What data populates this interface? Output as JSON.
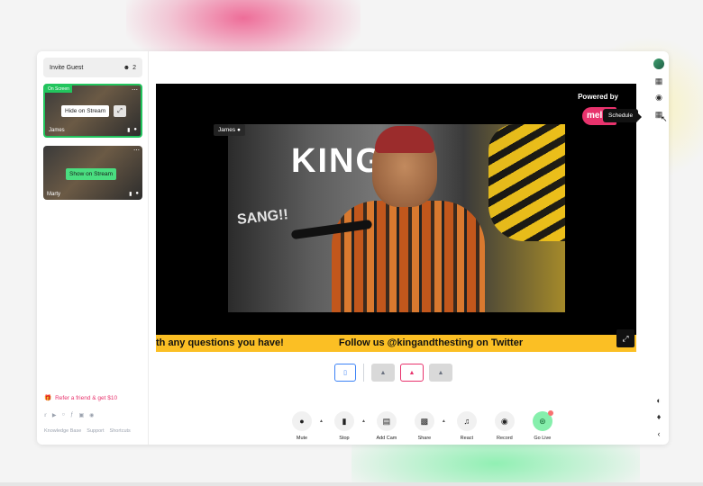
{
  "sidebar": {
    "invite_label": "Invite Guest",
    "guest_count": "2",
    "tiles": [
      {
        "name": "James",
        "badge": "On Screen",
        "action": "Hide on Stream"
      },
      {
        "name": "Marty",
        "badge": "",
        "action": "Show on Stream"
      }
    ],
    "refer_label": "Refer a friend & get $10",
    "footer_links": [
      "Knowledge Base",
      "Support",
      "Shortcuts"
    ],
    "socials": [
      "twitter-icon",
      "youtube-icon",
      "instagram-icon",
      "facebook-icon",
      "linkedin-icon",
      "discord-icon"
    ]
  },
  "stage": {
    "powered_by": "Powered by",
    "logo_text": "mel",
    "speaker_tag": "James",
    "ticker": [
      "th any questions you have!",
      "Follow us @kingandthesting on Twitter"
    ],
    "wall_text": "KING",
    "wall_text2": "SANG!!"
  },
  "tooltip": "Schedule",
  "controls": [
    {
      "label": "Mute",
      "icon": "mic-icon",
      "caret": true
    },
    {
      "label": "Stop",
      "icon": "camera-icon",
      "caret": true
    },
    {
      "label": "Add Cam",
      "icon": "add-camera-icon",
      "caret": false
    },
    {
      "label": "Share",
      "icon": "screen-share-icon",
      "caret": true
    },
    {
      "label": "React",
      "icon": "music-note-icon",
      "caret": false
    },
    {
      "label": "Record",
      "icon": "record-icon",
      "caret": false
    },
    {
      "label": "Go Live",
      "icon": "broadcast-icon",
      "caret": false
    }
  ],
  "colors": {
    "brand_pink": "#e8336d",
    "on_screen_green": "#22c55e",
    "ticker_yellow": "#fbbf24",
    "layout_phone_blue": "#3b82f6"
  }
}
